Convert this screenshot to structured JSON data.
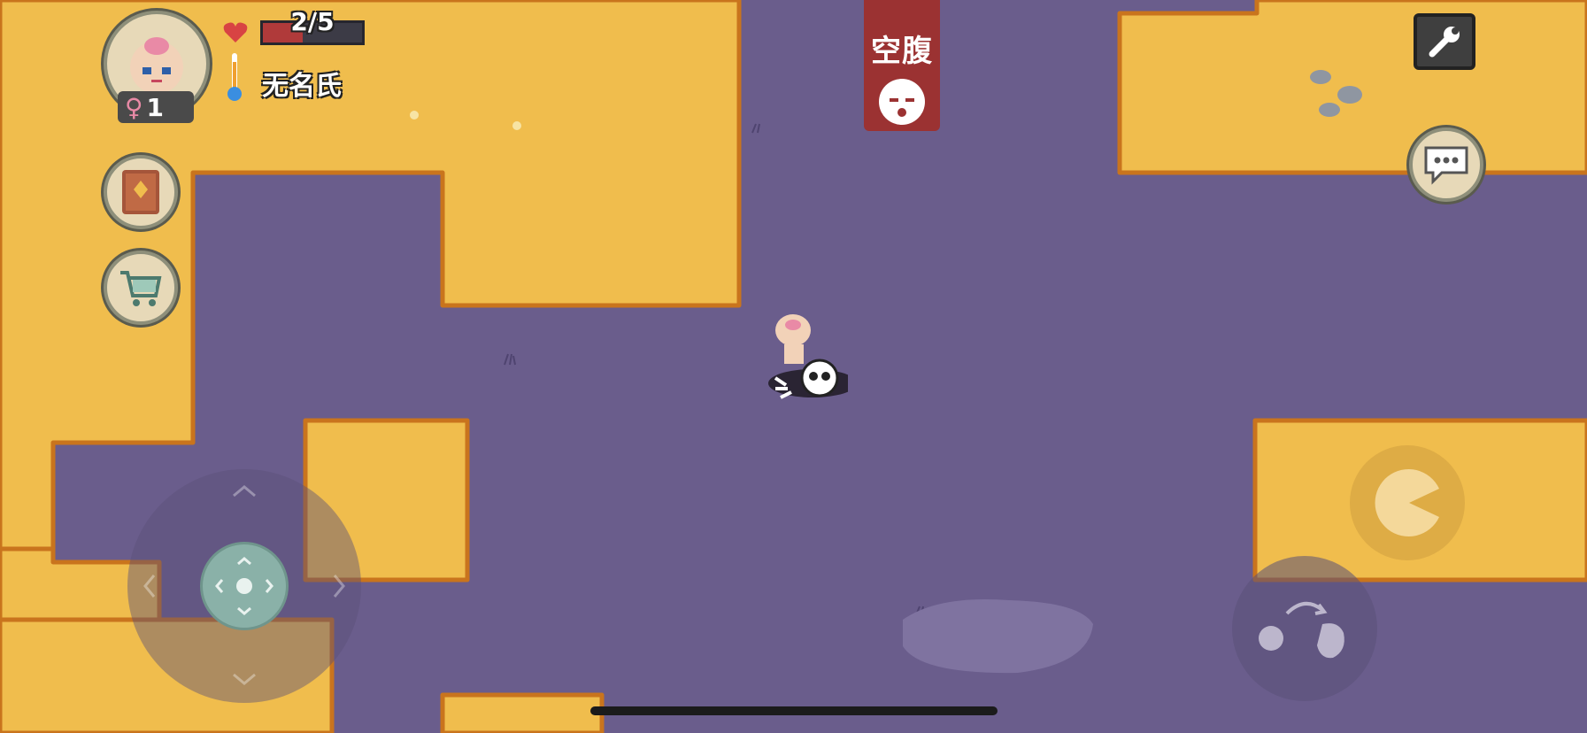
{
  "hud": {
    "health_text": "2/5",
    "health": {
      "current": 2,
      "max": 5
    },
    "player_name": "无名氏",
    "gender_symbol": "♀",
    "gender_count": "1"
  },
  "status": {
    "label": "空腹"
  },
  "icons": {
    "portrait": "character-portrait-icon",
    "heart": "heart-icon",
    "thermometer": "thermometer-icon",
    "book": "journal-book-icon",
    "cart": "shopping-cart-icon",
    "settings": "wrench-icon",
    "chat": "chat-bubble-icon",
    "eat": "eat-pacman-icon",
    "throw": "throw-hand-icon",
    "hunger": "hungry-face-icon"
  },
  "colors": {
    "sand": "#f0bd4d",
    "void": "#6a5d8c",
    "edge": "#c9741d",
    "status_red": "#9b3232",
    "health_red": "#b03a3a"
  }
}
